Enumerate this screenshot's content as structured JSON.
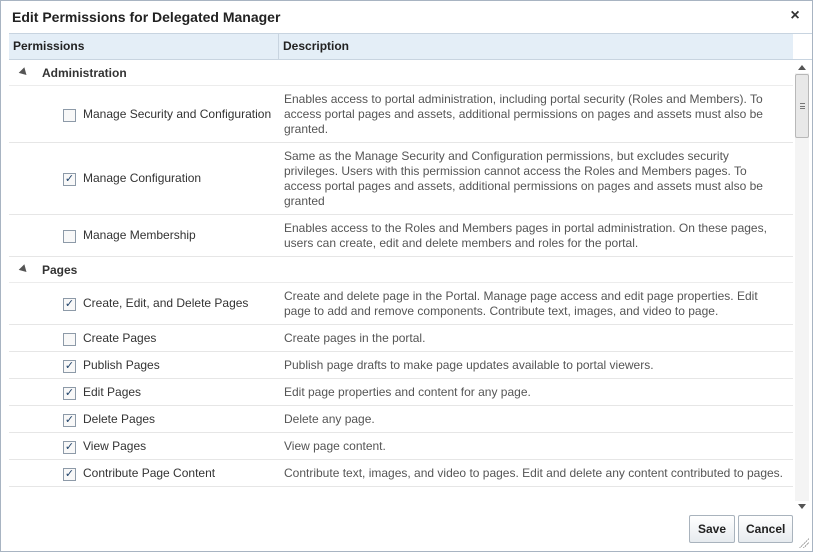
{
  "dialog": {
    "title": "Edit Permissions for Delegated Manager",
    "close_icon": "×"
  },
  "table": {
    "headers": {
      "permissions": "Permissions",
      "description": "Description"
    },
    "groups": [
      {
        "label": "Administration",
        "items": [
          {
            "label": "Manage Security and Configuration",
            "checked": false,
            "description": "Enables access to portal administration, including portal security (Roles and Members). To access portal pages and assets, additional permissions on pages and assets must also be granted."
          },
          {
            "label": "Manage Configuration",
            "checked": true,
            "description": "Same as the Manage Security and Configuration permissions, but excludes security privileges. Users with this permission cannot access the Roles and Members pages. To access portal pages and assets, additional permissions on pages and assets must also be granted"
          },
          {
            "label": "Manage Membership",
            "checked": false,
            "description": "Enables access to the Roles and Members pages in portal administration. On these pages, users can create, edit and delete members and roles for the portal."
          }
        ]
      },
      {
        "label": "Pages",
        "items": [
          {
            "label": "Create, Edit, and Delete Pages",
            "checked": true,
            "description": "Create and delete page in the Portal. Manage page access and edit page properties. Edit page to add and remove components. Contribute text, images, and video to page."
          },
          {
            "label": "Create Pages",
            "checked": false,
            "description": "Create pages in the portal."
          },
          {
            "label": "Publish Pages",
            "checked": true,
            "description": "Publish page drafts to make page updates available to portal viewers."
          },
          {
            "label": "Edit Pages",
            "checked": true,
            "description": "Edit page properties and content for any page."
          },
          {
            "label": "Delete Pages",
            "checked": true,
            "description": "Delete any page."
          },
          {
            "label": "View Pages",
            "checked": true,
            "description": "View page content."
          },
          {
            "label": "Contribute Page Content",
            "checked": true,
            "description": "Contribute text, images, and video to pages. Edit and delete any content contributed to pages."
          }
        ]
      }
    ]
  },
  "footer": {
    "save_label": "Save",
    "cancel_label": "Cancel"
  },
  "colors": {
    "header_bg": "#e4eef7",
    "border": "#a8b4c2",
    "check": "#22446a"
  }
}
